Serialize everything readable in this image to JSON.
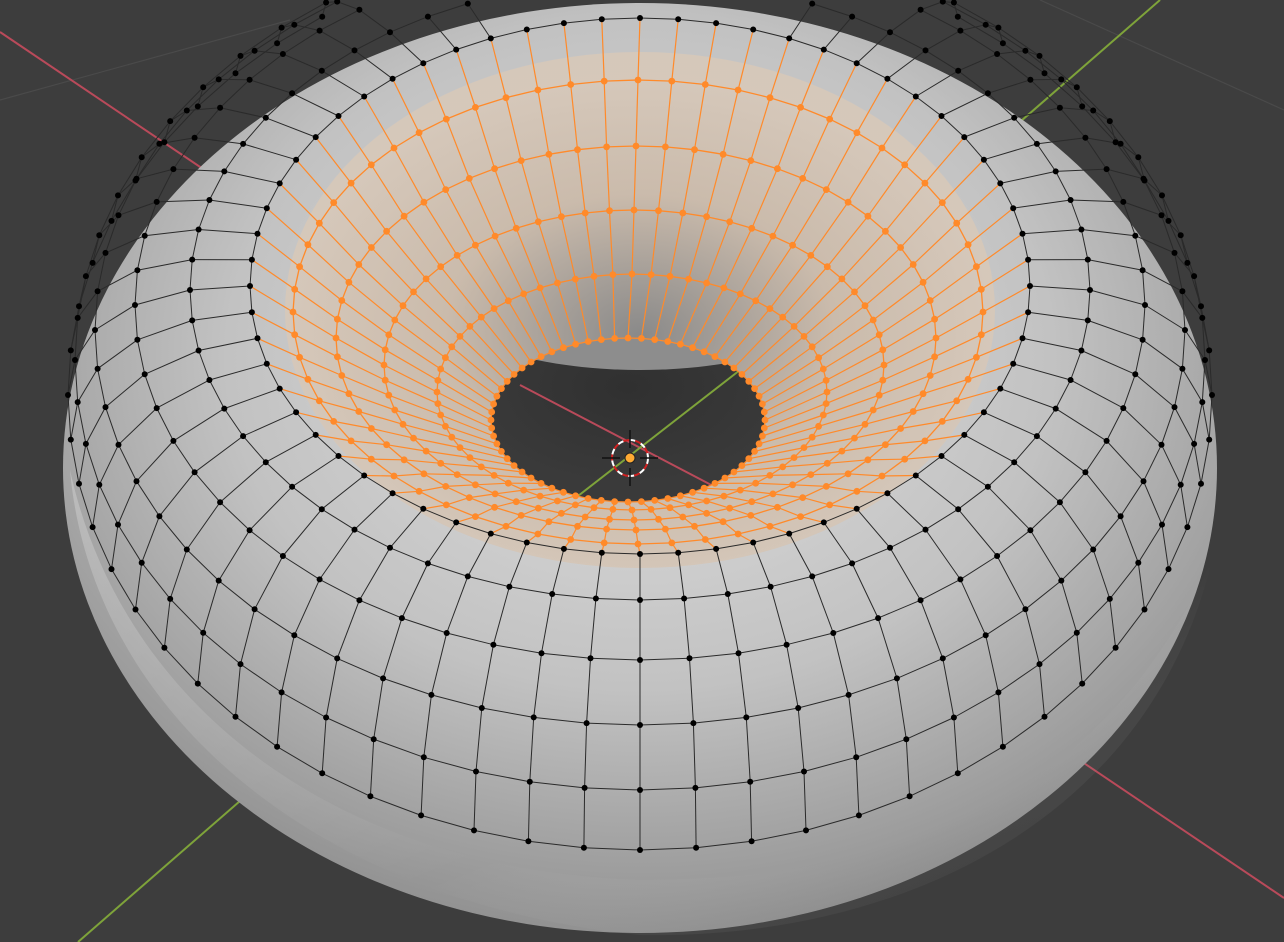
{
  "viewport": {
    "background_color": "#3d3d3d",
    "grid_line_color": "#4a4a4a",
    "x_axis_color": "#b94a5a",
    "y_axis_color": "#7ea33a"
  },
  "mesh": {
    "object_type": "torus",
    "mode": "edit",
    "surface_color": "#bdbdbd",
    "edge_color": "#2a2a2a",
    "vertex_color": "#000000",
    "selection_color": "#ff8a2a",
    "selected_region": "inner-ring"
  },
  "cursor": {
    "icon": "3d-cursor-icon",
    "ring_color_a": "#ffffff",
    "ring_color_b": "#d02020"
  },
  "origin": {
    "icon": "object-origin-icon",
    "color": "#ffaa33"
  }
}
